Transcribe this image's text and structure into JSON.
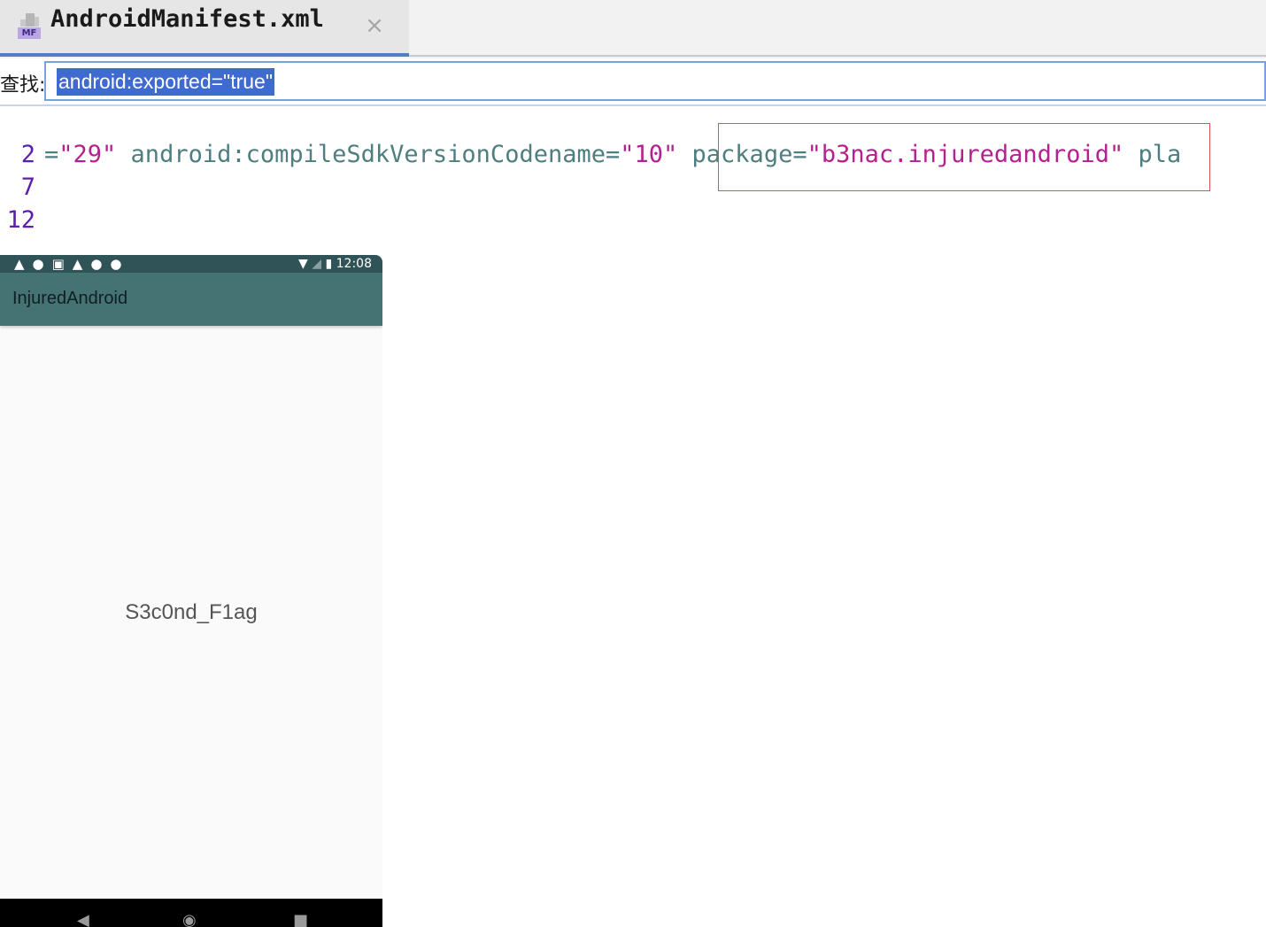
{
  "tab": {
    "icon_label": "MF",
    "title": "AndroidManifest.xml",
    "close_glyph": "×"
  },
  "find": {
    "label": "查找:",
    "value": "android:exported=\"true\""
  },
  "code": {
    "lines": [
      {
        "number": "2",
        "segments": [
          {
            "text": "=",
            "kind": "attr"
          },
          {
            "text": "\"29\"",
            "kind": "str"
          },
          {
            "text": " android:compileSdkVersionCodename=",
            "kind": "attr"
          },
          {
            "text": "\"10\"",
            "kind": "str"
          },
          {
            "text": " package=",
            "kind": "attr"
          },
          {
            "text": "\"b3nac.injuredandroid\"",
            "kind": "str"
          },
          {
            "text": " pla",
            "kind": "attr"
          }
        ]
      },
      {
        "number": "7"
      },
      {
        "number": "12"
      }
    ]
  },
  "phone": {
    "statusbar": {
      "left_icons": "▲●▣▲●●",
      "time": "12:08"
    },
    "app_title": "InjuredAndroid",
    "flag_text": "S3c0nd_F1ag",
    "nav": {
      "back": "◀",
      "home": "◉",
      "recent": "■"
    }
  },
  "colors": {
    "tab_underline": "#4f7fc0",
    "selection": "#3f6bd0",
    "line_number": "#5b1fb0",
    "string": "#b5208f",
    "attribute": "#4f7e80",
    "highlight_box": "#e0505a",
    "appbar": "#457273",
    "statusbar": "#2f5356"
  }
}
